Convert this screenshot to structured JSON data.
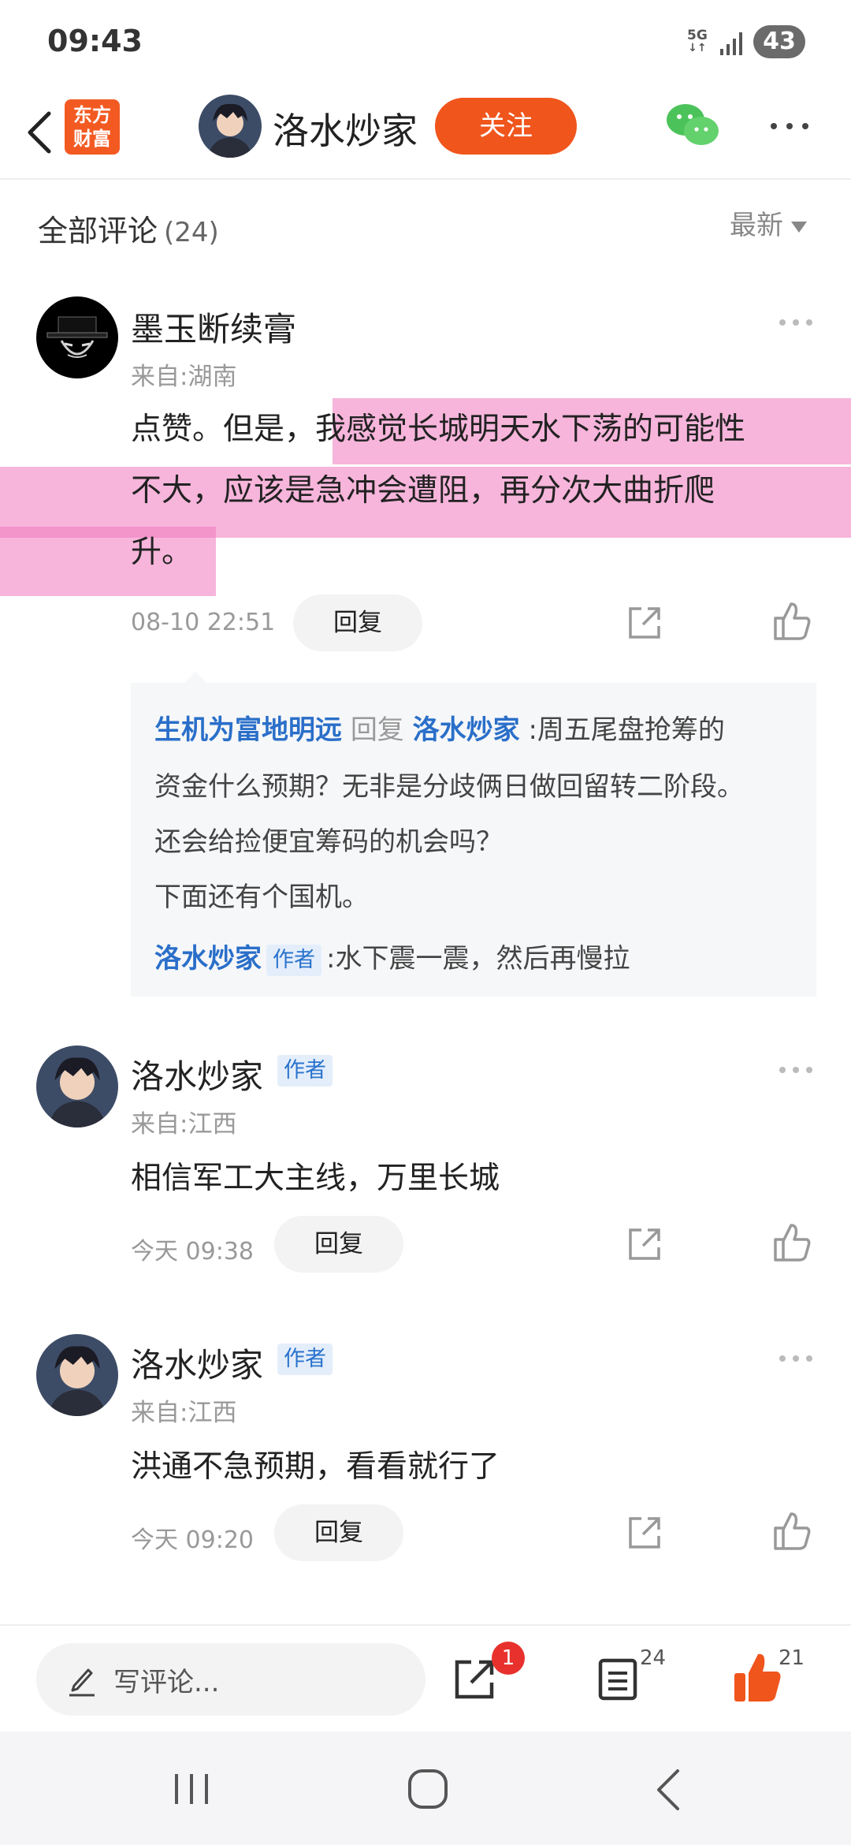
{
  "status_bar": {
    "time": "09:43",
    "network": "5G",
    "battery": "43"
  },
  "header": {
    "app_logo_line1": "东方",
    "app_logo_line2": "财富",
    "user_name": "洛水炒家",
    "follow_label": "关注"
  },
  "comments_header": {
    "title": "全部评论",
    "count": "(24)",
    "sort_label": "最新"
  },
  "comments": [
    {
      "name": "墨玉断续膏",
      "location": "来自:湖南",
      "text_plain": "点赞。但是，",
      "text_highlight_1": "我感觉长城明天水下荡的可能性",
      "text_highlight_2": "不大，应该是急冲会遭阻，再分次大曲折爬",
      "text_highlight_3": "升。",
      "time": "08-10 22:51",
      "reply_label": "回复"
    },
    {
      "name": "洛水炒家",
      "badge": "作者",
      "location": "来自:江西",
      "text": "相信军工大主线，万里长城",
      "time": "今天 09:38",
      "reply_label": "回复"
    },
    {
      "name": "洛水炒家",
      "badge": "作者",
      "location": "来自:江西",
      "text": "洪通不急预期，看看就行了",
      "time": "今天 09:20",
      "reply_label": "回复"
    }
  ],
  "reply_thread": {
    "reply_from": "生机为富地明远",
    "reply_word": "回复",
    "reply_to": "洛水炒家",
    "line1": ":周五尾盘抢筹的",
    "line2": "资金什么预期？无非是分歧俩日做回留转二阶段。",
    "line3": "还会给捡便宜筹码的机会吗？",
    "line4": "下面还有个国机。",
    "author_reply_name": "洛水炒家",
    "author_badge": "作者",
    "author_reply_text": ":水下震一震，然后再慢拉"
  },
  "bottom_bar": {
    "write_placeholder": "写评论...",
    "share_badge": "1",
    "comment_count": "24",
    "like_count": "21"
  },
  "colors": {
    "accent": "#f0551c",
    "link_blue": "#2a6fc9",
    "highlight": "#f078be"
  },
  "icons": [
    "back-icon",
    "wechat-icon",
    "more-icon",
    "share-icon",
    "like-icon",
    "pen-icon",
    "list-icon",
    "thumb-up-icon",
    "recent-apps-icon",
    "home-icon",
    "nav-back-icon"
  ]
}
